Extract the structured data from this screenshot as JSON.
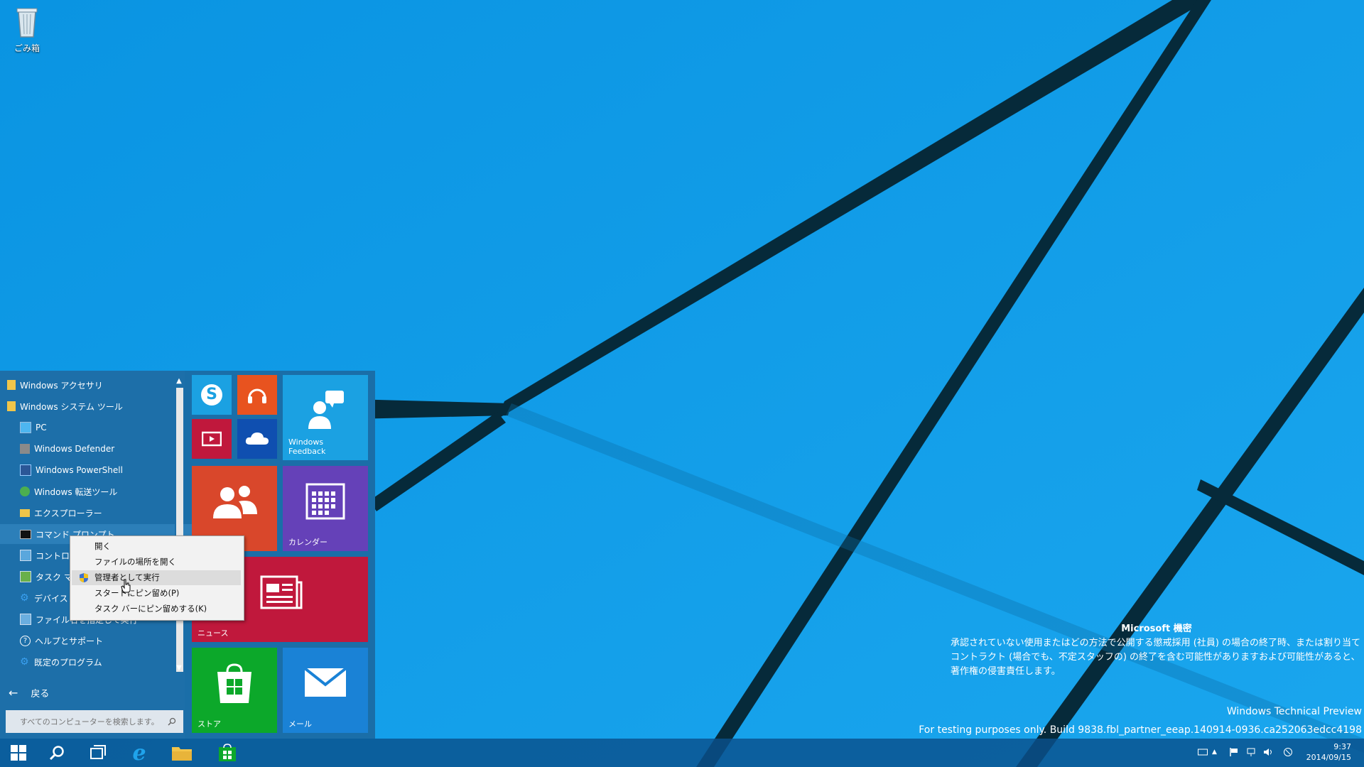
{
  "desktop": {
    "recycle_bin_label": "ごみ箱"
  },
  "start_menu": {
    "apps": [
      {
        "label": "Windows アクセサリ",
        "icon": "folder-icon"
      },
      {
        "label": "Windows システム ツール",
        "icon": "folder-icon"
      },
      {
        "label": "PC",
        "icon": "pc-icon"
      },
      {
        "label": "Windows Defender",
        "icon": "defender-icon"
      },
      {
        "label": "Windows PowerShell",
        "icon": "powershell-icon"
      },
      {
        "label": "Windows 転送ツール",
        "icon": "transfer-icon"
      },
      {
        "label": "エクスプローラー",
        "icon": "explorer-icon"
      },
      {
        "label": "コマンド プロンプト",
        "icon": "cmd-icon"
      },
      {
        "label": "コントロール",
        "icon": "control-panel-icon"
      },
      {
        "label": "タスク マネ",
        "icon": "task-manager-icon"
      },
      {
        "label": "デバイス",
        "icon": "gear-icon"
      },
      {
        "label": "ファイル名を指定して実行",
        "icon": "run-icon"
      },
      {
        "label": "ヘルプとサポート",
        "icon": "help-icon"
      },
      {
        "label": "既定のプログラム",
        "icon": "gear-icon"
      }
    ],
    "back_label": "戻る",
    "search_placeholder": "すべてのコンピューターを検索します。",
    "tiles": {
      "windows_feedback": "Windows\nFeedback",
      "calendar": "カレンダー",
      "news": "ニュース",
      "store": "ストア",
      "mail": "メール"
    }
  },
  "context_menu": {
    "items": [
      "開く",
      "ファイルの場所を開く",
      "管理者として実行",
      "スタートにピン留め(P)",
      "タスク バーにピン留めする(K)"
    ]
  },
  "watermark": {
    "confidential_title": "Microsoft 機密",
    "confidential_body": "承認されていない使用またはどの方法で公開する懲戒採用 (社員) の場合の終了時、または割り当てコントラクト (場合でも、不定スタッフの) の終了を含む可能性がありますおよび可能性があると、著作権の侵害責任します。",
    "edition": "Windows Technical Preview",
    "build": "For testing purposes only. Build 9838.fbl_partner_eeap.140914-0936.ca252063edcc4198"
  },
  "taskbar": {
    "time": "9:37",
    "date": "2014/09/15"
  },
  "colors": {
    "wallpaper": "#0a9ae6",
    "tile_blue": "#1ba1e2",
    "tile_orange": "#e8531f",
    "tile_red_orange": "#d9472b",
    "tile_purple": "#6541b8",
    "tile_crimson": "#c0183c",
    "tile_green": "#0ca82a",
    "tile_darkblue": "#0f4fb0"
  }
}
